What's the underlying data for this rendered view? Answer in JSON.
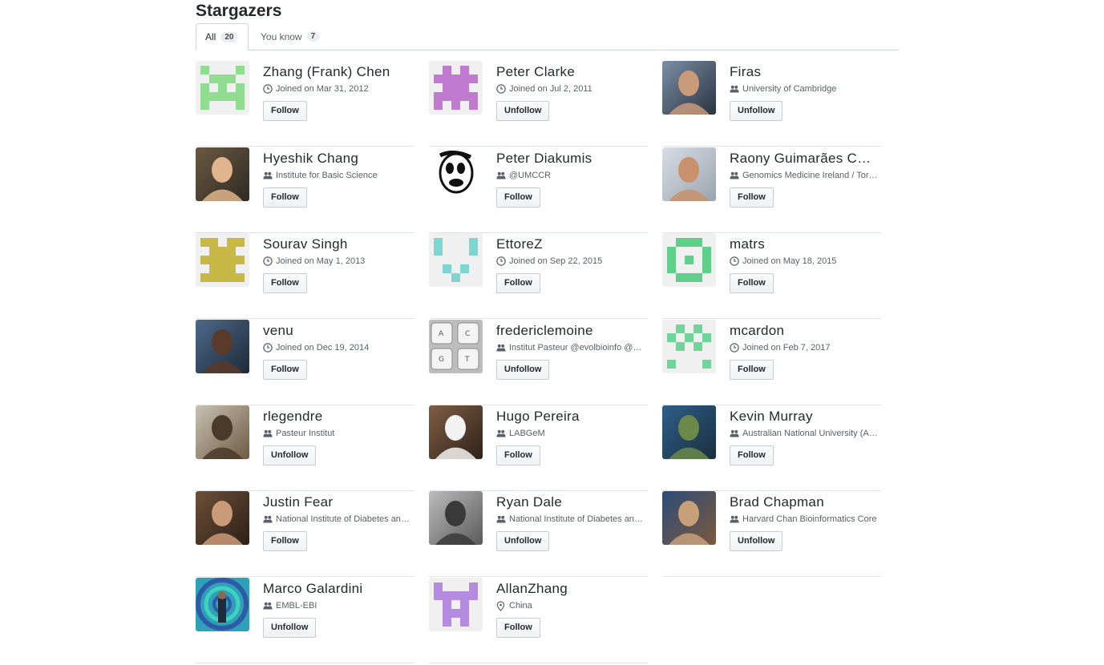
{
  "page": {
    "title": "Stargazers"
  },
  "tabs": [
    {
      "label": "All",
      "count": "20"
    },
    {
      "label": "You know",
      "count": "7"
    }
  ],
  "users": [
    {
      "name": "Zhang (Frank) Chen",
      "meta_icon": "clock-icon",
      "meta": "Joined on Mar 31, 2012",
      "button": "Follow"
    },
    {
      "name": "Peter Clarke",
      "meta_icon": "clock-icon",
      "meta": "Joined on Jul 2, 2011",
      "button": "Unfollow"
    },
    {
      "name": "Firas",
      "meta_icon": "organization-icon",
      "meta": "University of Cambridge",
      "button": "Unfollow"
    },
    {
      "name": "Hyeshik Chang",
      "meta_icon": "organization-icon",
      "meta": "Institute for Basic Science",
      "button": "Follow"
    },
    {
      "name": "Peter Diakumis",
      "meta_icon": "organization-icon",
      "meta": "@UMCCR",
      "button": "Follow"
    },
    {
      "name": "Raony Guimarães Corrêa",
      "meta_icon": "organization-icon",
      "meta": "Genomics Medicine Ireland / Torcedor",
      "button": "Follow"
    },
    {
      "name": "Sourav Singh",
      "meta_icon": "clock-icon",
      "meta": "Joined on May 1, 2013",
      "button": "Follow"
    },
    {
      "name": "EttoreZ",
      "meta_icon": "clock-icon",
      "meta": "Joined on Sep 22, 2015",
      "button": "Follow"
    },
    {
      "name": "matrs",
      "meta_icon": "clock-icon",
      "meta": "Joined on May 18, 2015",
      "button": "Follow"
    },
    {
      "name": "venu",
      "meta_icon": "clock-icon",
      "meta": "Joined on Dec 19, 2014",
      "button": "Follow"
    },
    {
      "name": "fredericlemoine",
      "meta_icon": "organization-icon",
      "meta": "Institut Pasteur @evolbioinfo @Cloud",
      "button": "Unfollow"
    },
    {
      "name": "mcardon",
      "meta_icon": "clock-icon",
      "meta": "Joined on Feb 7, 2017",
      "button": "Follow"
    },
    {
      "name": "rlegendre",
      "meta_icon": "organization-icon",
      "meta": "Pasteur Institut",
      "button": "Unfollow"
    },
    {
      "name": "Hugo Pereira",
      "meta_icon": "organization-icon",
      "meta": "LABGeM",
      "button": "Follow"
    },
    {
      "name": "Kevin Murray",
      "meta_icon": "organization-icon",
      "meta": "Australian National University (ANU)",
      "button": "Follow"
    },
    {
      "name": "Justin Fear",
      "meta_icon": "organization-icon",
      "meta": "National Institute of Diabetes and Digestive",
      "button": "Follow"
    },
    {
      "name": "Ryan Dale",
      "meta_icon": "organization-icon",
      "meta": "National Institute of Diabetes and Digestive",
      "button": "Unfollow"
    },
    {
      "name": "Brad Chapman",
      "meta_icon": "organization-icon",
      "meta": "Harvard Chan Bioinformatics Core",
      "button": "Unfollow"
    },
    {
      "name": "Marco Galardini",
      "meta_icon": "organization-icon",
      "meta": "EMBL-EBI",
      "button": "Unfollow"
    },
    {
      "name": "AllanZhang",
      "meta_icon": "location-icon",
      "meta": "China",
      "button": "Follow"
    }
  ]
}
